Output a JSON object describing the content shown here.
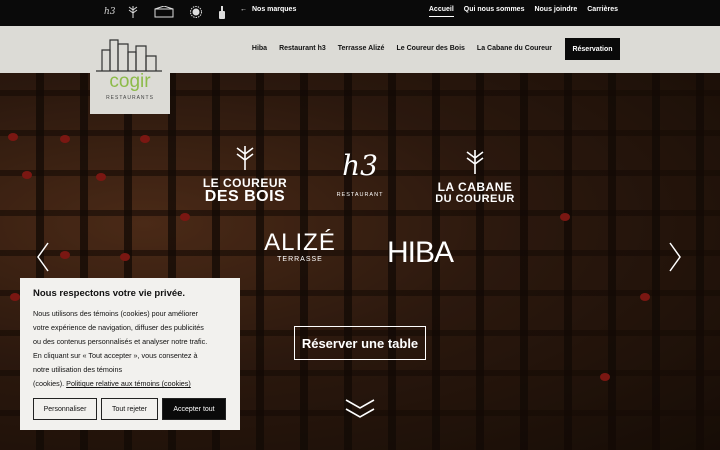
{
  "topbar": {
    "brand_icons": [
      "h3-icon",
      "tree-icon",
      "cabin-icon",
      "sun-icon",
      "bottle-icon"
    ],
    "brand_h3": "h3",
    "back_label": "Nos marques",
    "links": [
      "Accueil",
      "Qui nous sommes",
      "Nous joindre",
      "Carrières"
    ],
    "active_link": "Accueil"
  },
  "logo": {
    "name": "cogir",
    "sub": "RESTAURANTS"
  },
  "nav": {
    "links": [
      "Hiba",
      "Restaurant h3",
      "Terrasse Alizé",
      "Le Coureur des Bois",
      "La Cabane du Coureur"
    ],
    "cta": "Réservation"
  },
  "hero": {
    "restaurants": {
      "coureur": {
        "line1": "LE COUREUR",
        "line2": "DES BOIS"
      },
      "h3": {
        "mark": "h3",
        "sub": "RESTAURANT"
      },
      "cabane": {
        "line1": "LA CABANE",
        "line2": "DU COUREUR"
      },
      "alize": {
        "name": "ALIZÉ",
        "sub": "TERRASSE"
      },
      "hiba": {
        "name": "HIBA"
      }
    },
    "prev_icon": "chevron-left-icon",
    "next_icon": "chevron-right-icon",
    "reserve_table": "Réserver une table",
    "scroll_icon": "double-chevron-down-icon"
  },
  "cookie": {
    "title": "Nous respectons votre vie privée.",
    "line1": "Nous utilisons des témoins (cookies) pour améliorer",
    "line2": "votre expérience de navigation, diffuser des publicités",
    "line3": "ou des contenus personnalisés et analyser notre trafic.",
    "line4": "En cliquant sur « Tout accepter », vous consentez à",
    "line5": "notre utilisation des témoins",
    "line6": "(cookies).",
    "policy": "Politique relative aux témoins (cookies)",
    "customize": "Personnaliser",
    "reject": "Tout rejeter",
    "accept": "Accepter tout"
  },
  "colors": {
    "topbar": "#0a0a0a",
    "navbar": "#dcdbd6",
    "logo_green": "#8dbb4a",
    "wine": "#7a1712"
  }
}
